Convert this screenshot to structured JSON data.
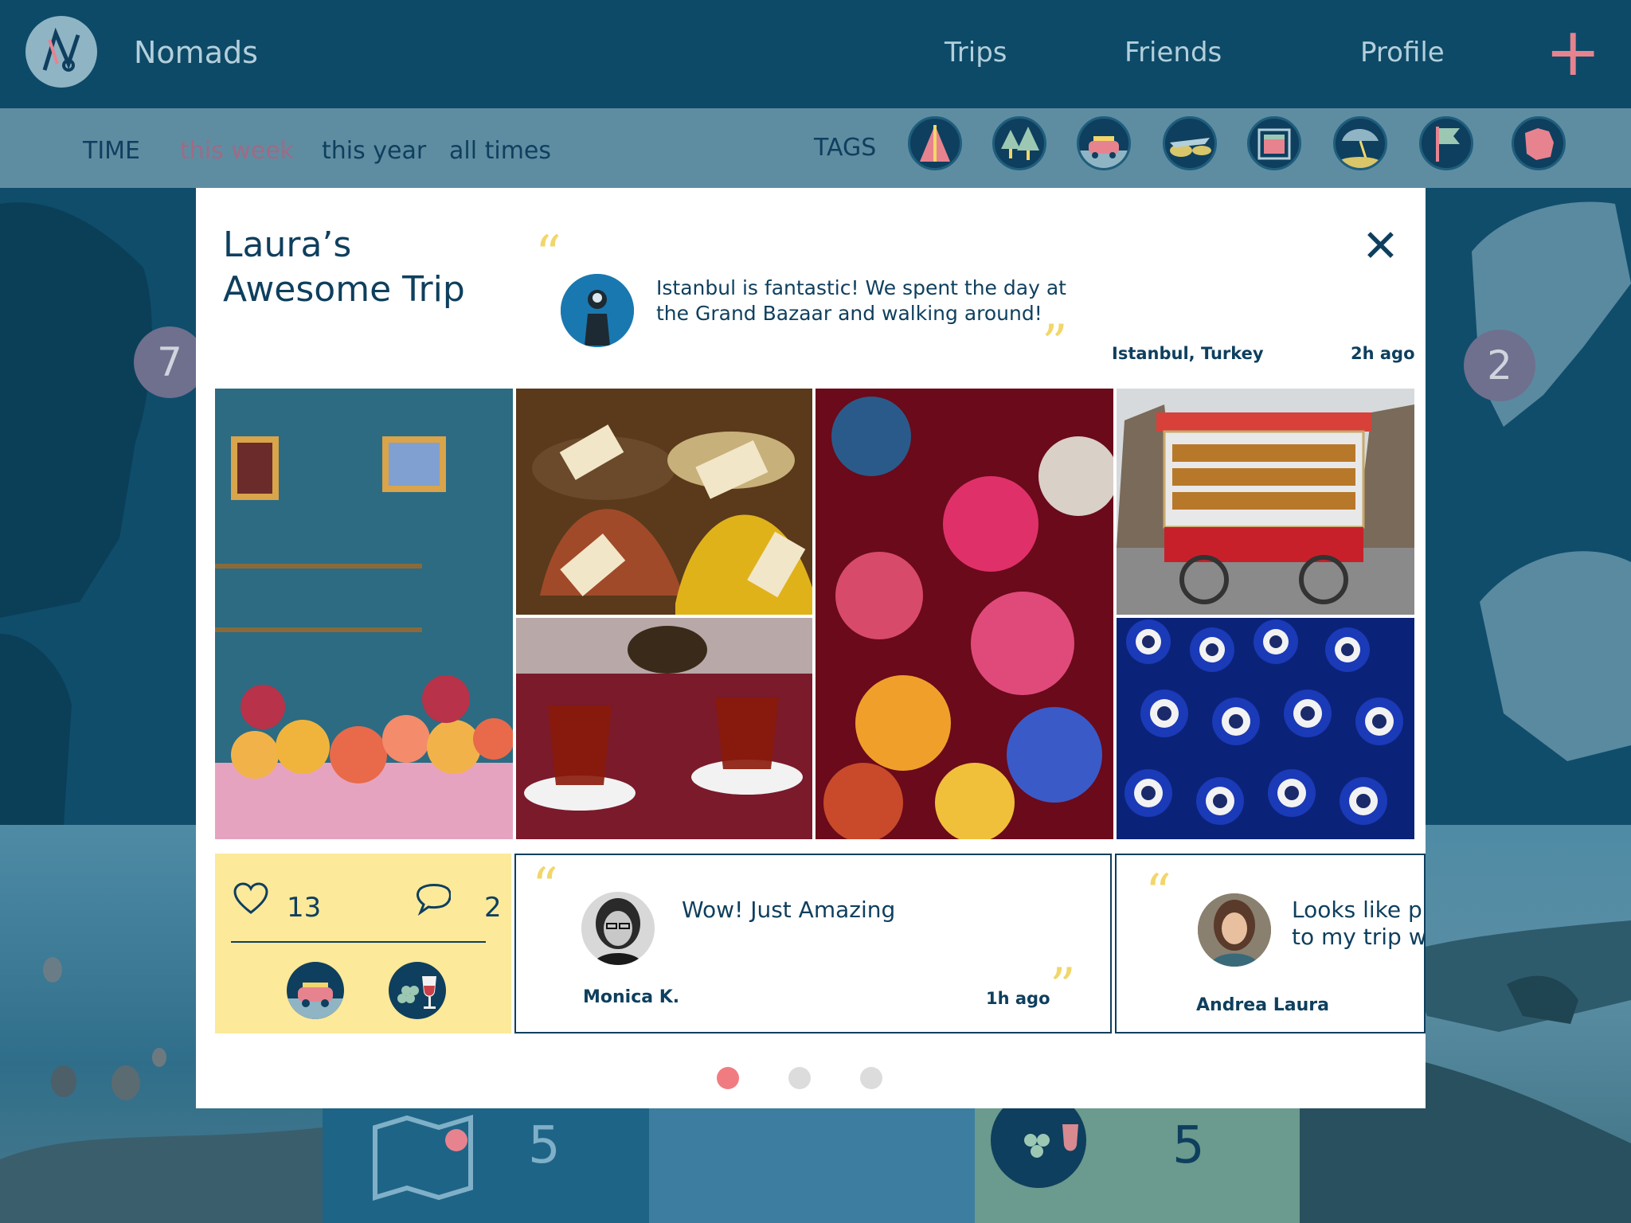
{
  "app": {
    "name": "Nomads"
  },
  "nav": {
    "items": [
      "Trips",
      "Friends",
      "Profile"
    ],
    "add_label": "+"
  },
  "filters": {
    "time_label": "TIME",
    "time_options": [
      "this week",
      "this year",
      "all times"
    ],
    "selected_time": "this week",
    "tags_label": "TAGS",
    "tags": [
      "camping-icon",
      "forest-icon",
      "road-trip-icon",
      "flight-icon",
      "city-icon",
      "beach-icon",
      "flag-icon",
      "map-region-icon"
    ]
  },
  "background": {
    "badge_left": "7",
    "badge_right": "2",
    "tiles": [
      {
        "icon": "map-pin-icon",
        "count": "5"
      },
      {
        "icon": "wine-icon",
        "count": "5"
      }
    ]
  },
  "post": {
    "title": "Laura’s Awesome Trip",
    "text": "Istanbul is fantastic! We spent the day at the Grand Bazaar and walking around!",
    "location": "Istanbul, Turkey",
    "time_ago": "2h ago",
    "close_label": "✕",
    "likes": "13",
    "comments_count": "2",
    "tag_icons": [
      "road-trip-icon",
      "wine-icon"
    ]
  },
  "comments": [
    {
      "text": "Wow! Just Amazing",
      "author": "Monica K.",
      "time_ago": "1h ago"
    },
    {
      "text_line1": "Looks like p",
      "text_line2": "to my trip w",
      "author": "Andrea Laura"
    }
  ],
  "pagination": {
    "count": 3,
    "active": 0
  },
  "colors": {
    "primary": "#0e3f5e",
    "accent": "#f07c82",
    "highlight": "#fde99a",
    "quote": "#f2d66a"
  }
}
